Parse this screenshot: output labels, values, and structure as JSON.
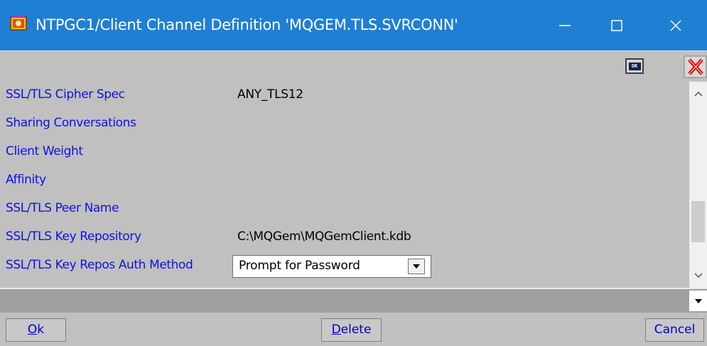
{
  "window": {
    "title": "NTPGC1/Client Channel Definition 'MQGEM.TLS.SVRCONN'",
    "title_bar_color": "#1f7fd4",
    "controls": [
      "minimize-icon",
      "maximize-icon",
      "close-icon"
    ]
  },
  "toolbar": {
    "ok_icon_text": "OK",
    "ok_icon": "ok-icon",
    "cancel_icon": "red-x-icon"
  },
  "fields": [
    {
      "label": "SSL/TLS Cipher Spec",
      "value": "ANY_TLS12"
    },
    {
      "label": "Sharing Conversations",
      "value": ""
    },
    {
      "label": "Client Weight",
      "value": ""
    },
    {
      "label": "Affinity",
      "value": ""
    },
    {
      "label": "SSL/TLS Peer Name",
      "value": ""
    },
    {
      "label": "SSL/TLS Key Repository",
      "value": "C:\\MQGem\\MQGemClient.kdb"
    },
    {
      "label": "SSL/TLS Key Repos Auth Method",
      "value": "Prompt for Password",
      "control": "dropdown"
    }
  ],
  "buttons": {
    "ok_prefix": "O",
    "ok_rest": "k",
    "delete_prefix": "D",
    "delete_rest": "elete",
    "cancel": "Cancel"
  },
  "colors": {
    "label": "#1010e0",
    "panel": "#c0c0c0",
    "button_text": "#0000c0"
  }
}
